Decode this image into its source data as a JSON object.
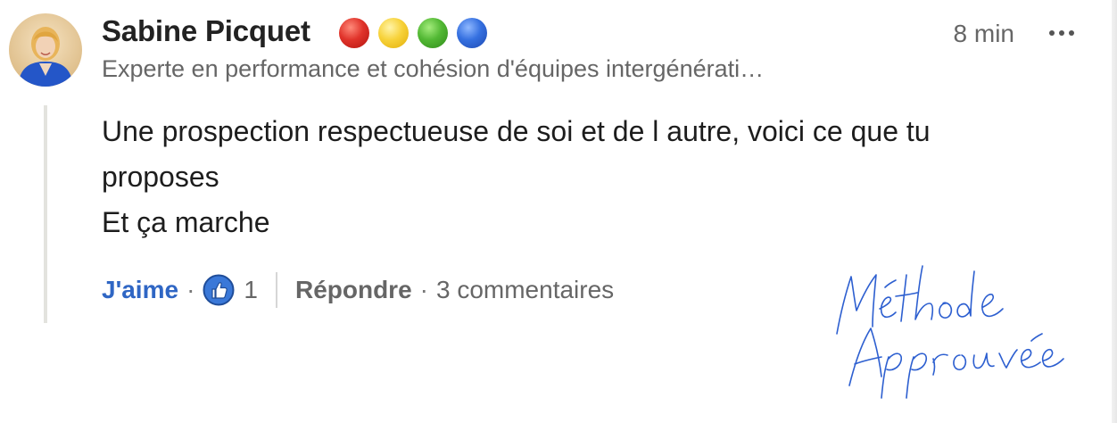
{
  "comment": {
    "author": {
      "name": "Sabine Picquet",
      "headline": "Experte en performance et cohésion d'équipes intergénérati…",
      "status_dots": [
        "red-circle-icon",
        "yellow-circle-icon",
        "green-circle-icon",
        "blue-circle-icon"
      ]
    },
    "timestamp": "8 min",
    "more_label": "•••",
    "body_lines": [
      "Une prospection respectueuse de soi et de l autre, voici ce que tu",
      "proposes",
      "Et ça marche"
    ],
    "actions": {
      "like_label": "J'aime",
      "separator": "·",
      "like_icon": "thumbs-up-icon",
      "reaction_count": "1",
      "reply_label": "Répondre",
      "comments_label": "3 commentaires"
    }
  },
  "signature": {
    "line1": "Méthode",
    "line2": "Approuvée"
  },
  "colors": {
    "link_blue": "#2f66c4",
    "text_dark": "#1d1d1d",
    "text_muted": "#666666",
    "signature_blue": "#2d5fd0"
  }
}
